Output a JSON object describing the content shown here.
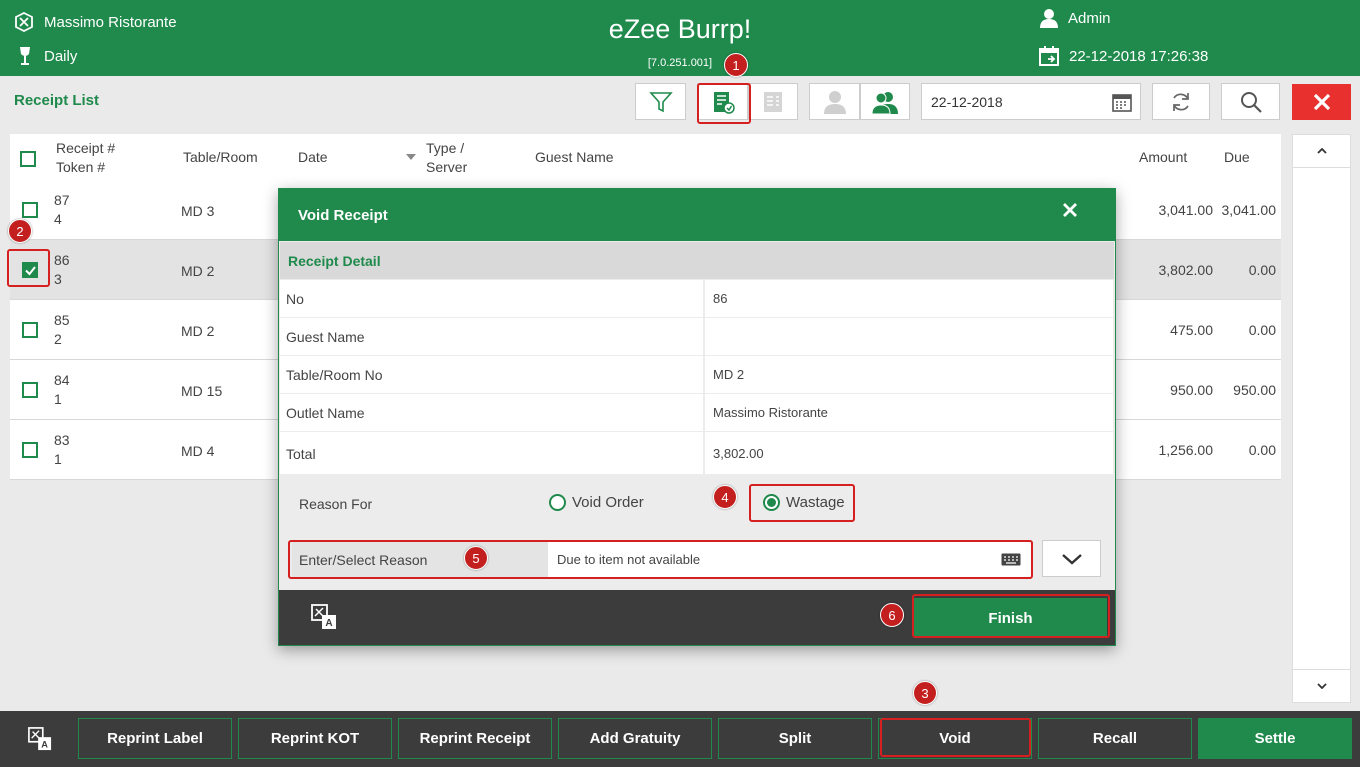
{
  "header": {
    "outlet": "Massimo Ristorante",
    "mode": "Daily",
    "app_title": "eZee Burrp!",
    "version": "[7.0.251.001]",
    "user": "Admin",
    "datetime": "22-12-2018 17:26:38"
  },
  "toolbar": {
    "title": "Receipt List",
    "date": "22-12-2018"
  },
  "table": {
    "columns": {
      "receipt": "Receipt #",
      "token": "Token #",
      "table_room": "Table/Room",
      "date": "Date",
      "type": "Type /",
      "server": "Server",
      "guest": "Guest Name",
      "amount": "Amount",
      "due": "Due"
    },
    "rows": [
      {
        "receipt": "87",
        "token": "4",
        "table": "MD 3",
        "amount": "3,041.00",
        "due": "3,041.00"
      },
      {
        "receipt": "86",
        "token": "3",
        "table": "MD 2",
        "amount": "3,802.00",
        "due": "0.00"
      },
      {
        "receipt": "85",
        "token": "2",
        "table": "MD 2",
        "amount": "475.00",
        "due": "0.00"
      },
      {
        "receipt": "84",
        "token": "1",
        "table": "MD 15",
        "amount": "950.00",
        "due": "950.00"
      },
      {
        "receipt": "83",
        "token": "1",
        "table": "MD 4",
        "amount": "1,256.00",
        "due": "0.00"
      }
    ]
  },
  "modal": {
    "title": "Void Receipt",
    "section": "Receipt Detail",
    "details": [
      {
        "label": "No",
        "value": "86"
      },
      {
        "label": "Guest Name",
        "value": ""
      },
      {
        "label": "Table/Room No",
        "value": "MD 2"
      },
      {
        "label": "Outlet Name",
        "value": "Massimo Ristorante"
      },
      {
        "label": "Total",
        "value": "3,802.00"
      }
    ],
    "reason_for": "Reason For",
    "option_void": "Void Order",
    "option_wastage": "Wastage",
    "reason_label": "Enter/Select Reason",
    "reason_value": "Due to item not available",
    "finish": "Finish"
  },
  "bottom_buttons": [
    "Reprint Label",
    "Reprint KOT",
    "Reprint Receipt",
    "Add Gratuity",
    "Split",
    "Void",
    "Recall",
    "Settle"
  ],
  "callouts": [
    "1",
    "2",
    "3",
    "4",
    "5",
    "6"
  ],
  "colors": {
    "brand": "#1f8a4c",
    "danger": "#e8302f",
    "highlight": "#d61f1f"
  }
}
